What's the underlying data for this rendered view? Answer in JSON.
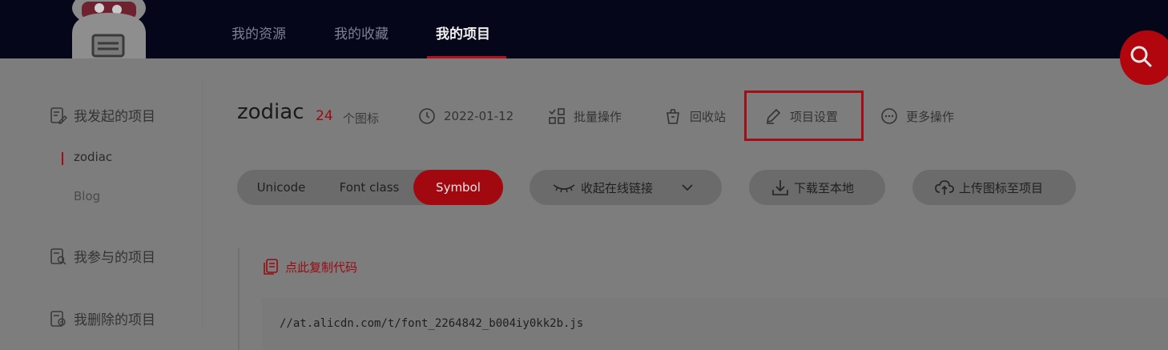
{
  "nav": {
    "items": [
      "我的资源",
      "我的收藏",
      "我的项目"
    ],
    "active_index": 2
  },
  "sidebar": {
    "groups": [
      {
        "label": "我发起的项目",
        "icon": "edit-doc-icon"
      },
      {
        "label": "我参与的项目",
        "icon": "doc-search-icon"
      },
      {
        "label": "我删除的项目",
        "icon": "doc-trash-icon"
      }
    ],
    "projects": [
      {
        "label": "zodiac",
        "active": true
      },
      {
        "label": "Blog",
        "active": false
      }
    ]
  },
  "project": {
    "name": "zodiac",
    "icon_count": "24",
    "icon_count_unit": "个图标",
    "date": "2022-01-12",
    "actions": {
      "batch": "批量操作",
      "recycle": "回收站",
      "settings": "项目设置",
      "more": "更多操作"
    }
  },
  "toolbar": {
    "tabs": [
      "Unicode",
      "Font class",
      "Symbol"
    ],
    "active_tab": "Symbol",
    "collapse_link": "收起在线链接",
    "download": "下载至本地",
    "upload": "上传图标至项目"
  },
  "code": {
    "copy_label": "点此复制代码",
    "url": "//at.alicdn.com/t/font_2264842_b004iy0kk2b.js"
  },
  "colors": {
    "topbar": "#06061a",
    "accent": "#a2080f",
    "overlay_bg": "#7d7d7d"
  }
}
